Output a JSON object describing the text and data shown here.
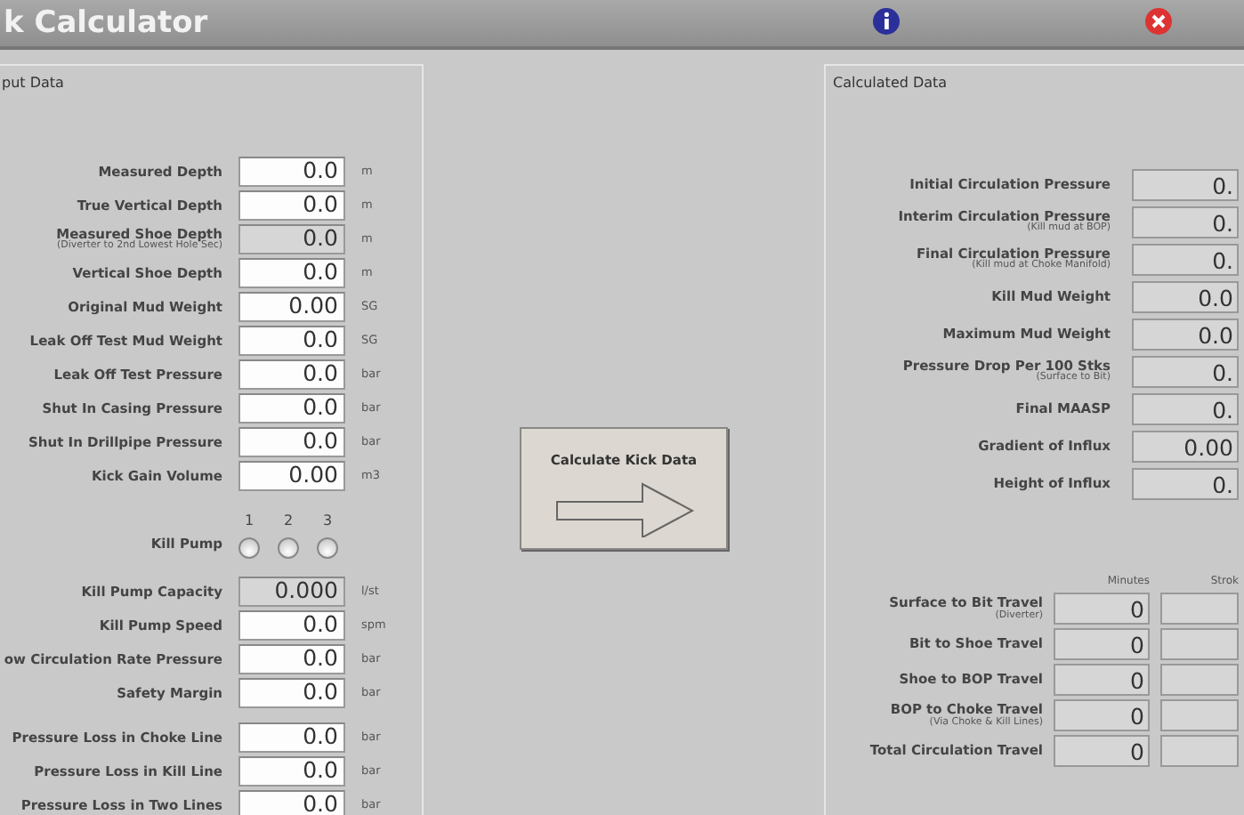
{
  "window": {
    "title": "k Calculator"
  },
  "input_panel": {
    "legend": "put Data",
    "sections": [
      [
        {
          "kind": "field",
          "label": "Measured Depth",
          "value": "0.0",
          "unit": "m",
          "disabled": false
        },
        {
          "kind": "field",
          "label": "True Vertical Depth",
          "value": "0.0",
          "unit": "m",
          "disabled": false
        },
        {
          "kind": "field",
          "label": "Measured Shoe Depth",
          "sub": "(Diverter to 2nd Lowest Hole Sec)",
          "value": "0.0",
          "unit": "m",
          "disabled": true
        },
        {
          "kind": "field",
          "label": "Vertical Shoe Depth",
          "value": "0.0",
          "unit": "m",
          "disabled": false
        },
        {
          "kind": "field",
          "label": "Original Mud Weight",
          "value": "0.00",
          "unit": "SG",
          "disabled": false
        },
        {
          "kind": "field",
          "label": "Leak Off Test Mud Weight",
          "value": "0.0",
          "unit": "SG",
          "disabled": false
        },
        {
          "kind": "field",
          "label": "Leak Off Test Pressure",
          "value": "0.0",
          "unit": "bar",
          "disabled": false
        },
        {
          "kind": "field",
          "label": "Shut In Casing Pressure",
          "value": "0.0",
          "unit": "bar",
          "disabled": false
        },
        {
          "kind": "field",
          "label": "Shut In Drillpipe Pressure",
          "value": "0.0",
          "unit": "bar",
          "disabled": false
        },
        {
          "kind": "field",
          "label": "Kick Gain Volume",
          "value": "0.00",
          "unit": "m3",
          "disabled": false
        }
      ],
      [
        {
          "kind": "radio",
          "label": "Kill Pump",
          "options": [
            {
              "label": "1",
              "selected": false
            },
            {
              "label": "2",
              "selected": false
            },
            {
              "label": "3",
              "selected": false
            }
          ]
        }
      ],
      [
        {
          "kind": "field",
          "label": "Kill Pump Capacity",
          "value": "0.000",
          "unit": "l/st",
          "disabled": true
        },
        {
          "kind": "field",
          "label": "Kill Pump Speed",
          "value": "0.0",
          "unit": "spm",
          "disabled": false
        },
        {
          "kind": "field",
          "label": "ow Circulation Rate Pressure",
          "value": "0.0",
          "unit": "bar",
          "disabled": false
        },
        {
          "kind": "field",
          "label": "Safety Margin",
          "value": "0.0",
          "unit": "bar",
          "disabled": false
        }
      ],
      [
        {
          "kind": "field",
          "label": "Pressure Loss in Choke Line",
          "value": "0.0",
          "unit": "bar",
          "disabled": false
        },
        {
          "kind": "field",
          "label": "Pressure Loss in Kill Line",
          "value": "0.0",
          "unit": "bar",
          "disabled": false
        },
        {
          "kind": "field",
          "label": "Pressure Loss in Two Lines",
          "value": "0.0",
          "unit": "bar",
          "disabled": false
        }
      ]
    ]
  },
  "calculate_button": {
    "label": "Calculate Kick Data"
  },
  "calculated_panel": {
    "legend": "Calculated Data",
    "results": [
      {
        "label": "Initial Circulation Pressure",
        "value": "0."
      },
      {
        "label": "Interim Circulation Pressure",
        "sub": "(Kill mud at BOP)",
        "value": "0."
      },
      {
        "label": "Final Circulation Pressure",
        "sub": "(Kill mud at Choke Manifold)",
        "value": "0."
      },
      {
        "label": "Kill Mud Weight",
        "value": "0.0"
      },
      {
        "label": "Maximum Mud Weight",
        "value": "0.0"
      },
      {
        "label": "Pressure Drop Per 100 Stks",
        "sub": "(Surface to Bit)",
        "value": "0."
      },
      {
        "label": "Final MAASP",
        "value": "0."
      },
      {
        "label": "Gradient of Influx",
        "value": "0.00"
      },
      {
        "label": "Height of Influx",
        "value": "0."
      }
    ],
    "travel": {
      "columns": [
        "Minutes",
        "Strok"
      ],
      "rows": [
        {
          "label": "Surface to Bit Travel",
          "sub": "(Diverter)",
          "minutes": "0"
        },
        {
          "label": "Bit to Shoe Travel",
          "minutes": "0"
        },
        {
          "label": "Shoe to BOP Travel",
          "minutes": "0"
        },
        {
          "label": "BOP to Choke Travel",
          "sub": "(Via Choke & Kill Lines)",
          "minutes": "0"
        },
        {
          "label": "Total Circulation Travel",
          "minutes": "0"
        }
      ]
    }
  }
}
